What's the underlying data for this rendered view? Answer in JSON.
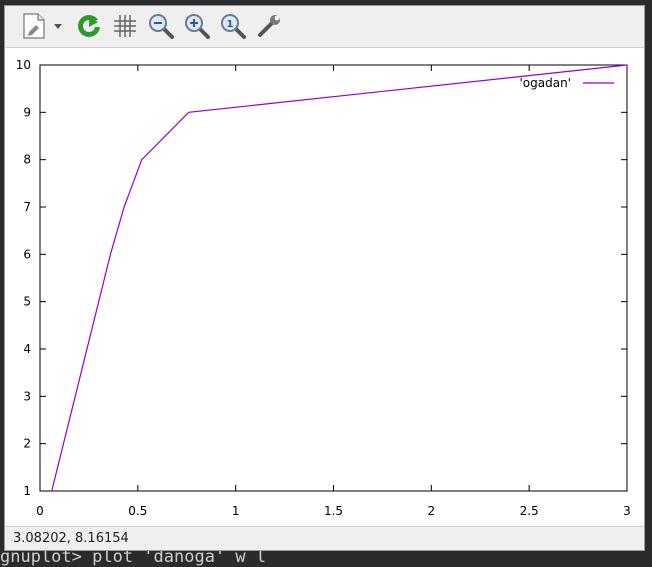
{
  "terminal": {
    "bottom_line": "gnuplot> plot 'danoga' w l"
  },
  "toolbar": {
    "icons": [
      "export-icon",
      "dropdown-arrow-icon",
      "replot-icon",
      "grid-icon",
      "zoom-out-icon",
      "zoom-in-icon",
      "zoom-reset-icon",
      "settings-icon"
    ]
  },
  "status": {
    "coordinates": "3.08202,  8.16154"
  },
  "chart_data": {
    "type": "line",
    "title": "",
    "xlabel": "",
    "ylabel": "",
    "xlim": [
      0,
      3
    ],
    "ylim": [
      1,
      10
    ],
    "grid": false,
    "legend_position": "top-right",
    "x_ticks": [
      "0",
      "0.5",
      "1",
      "1.5",
      "2",
      "2.5",
      "3"
    ],
    "y_ticks": [
      "1",
      "2",
      "3",
      "4",
      "5",
      "6",
      "7",
      "8",
      "9",
      "10"
    ],
    "series": [
      {
        "name": "'ogadan'",
        "color": "#9400d3",
        "x": [
          0.06,
          0.36,
          0.43,
          0.52,
          0.76,
          3.0
        ],
        "y": [
          1,
          6,
          7,
          8,
          9,
          10
        ]
      }
    ]
  }
}
